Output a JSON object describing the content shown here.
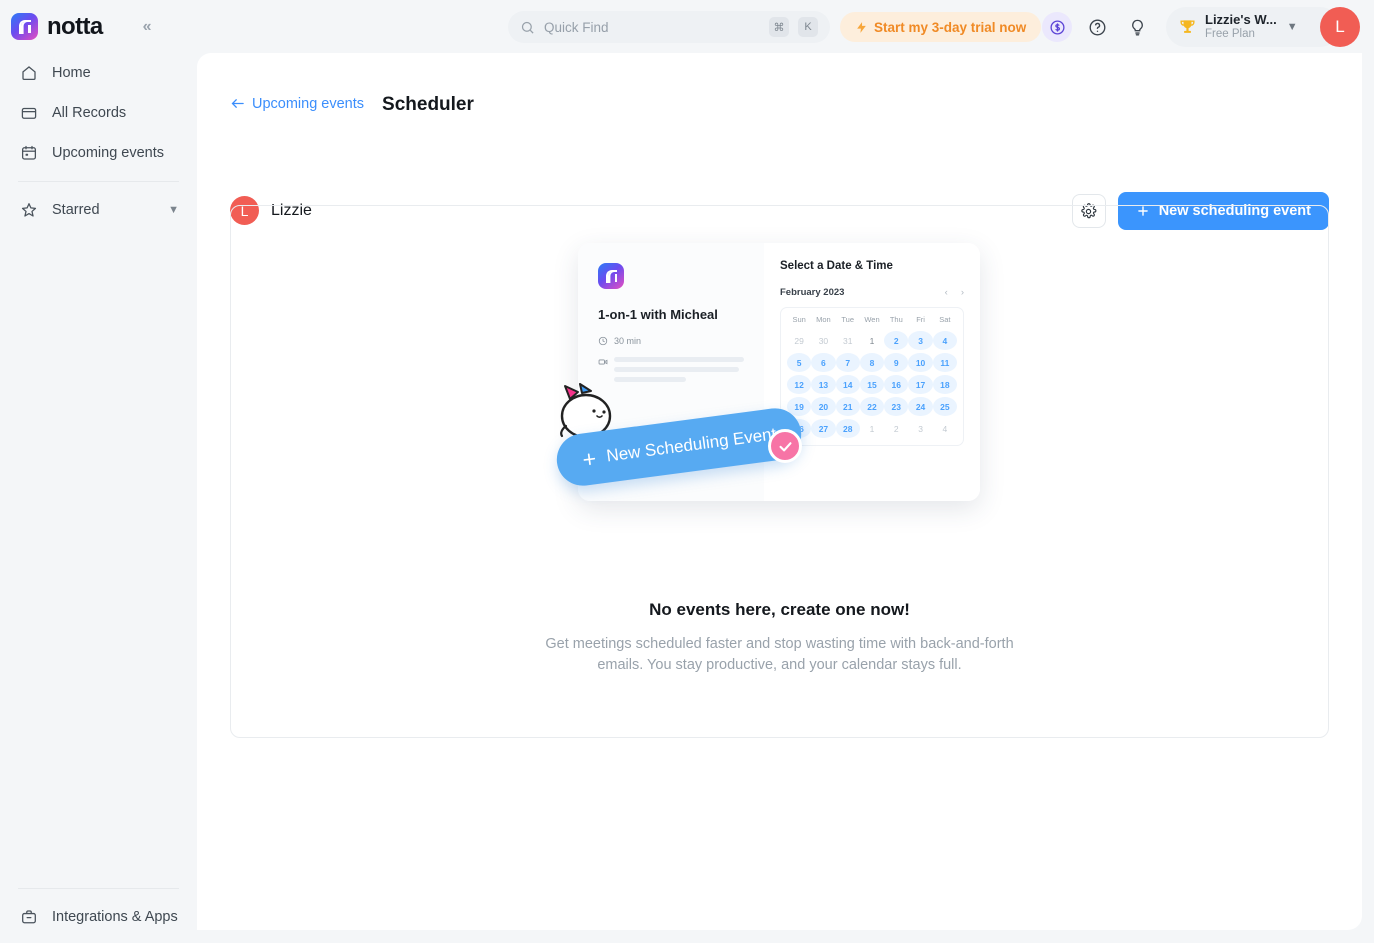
{
  "brand": {
    "name": "notta",
    "collapse_icon": "chevrons-left-icon"
  },
  "topbar": {
    "search": {
      "placeholder": "Quick Find",
      "icon": "search-icon",
      "shortcut_keys": [
        "⌘",
        "K"
      ]
    },
    "trial": {
      "label": "Start my 3-day trial now",
      "icon": "bolt-icon",
      "color": "#f08a25"
    },
    "coin_icon": "coin-dollar-icon",
    "help_icon": "help-circle-icon",
    "bulb_icon": "lightbulb-icon",
    "workspace": {
      "trophy_icon": "trophy-icon",
      "name": "Lizzie's W...",
      "plan": "Free Plan",
      "chevron_icon": "chevron-down-icon"
    },
    "avatar": {
      "initial": "L",
      "color": "#f15d54"
    }
  },
  "sidebar": {
    "items": [
      {
        "label": "Home",
        "icon": "home-icon"
      },
      {
        "label": "All Records",
        "icon": "folder-icon"
      },
      {
        "label": "Upcoming events",
        "icon": "calendar-icon"
      }
    ],
    "starred": {
      "label": "Starred",
      "icon": "star-icon",
      "chevron_icon": "chevron-down-icon"
    },
    "bottom": {
      "label": "Integrations & Apps",
      "icon": "briefcase-icon"
    }
  },
  "main": {
    "breadcrumb": {
      "back_label": "Upcoming events",
      "back_icon": "arrow-left-icon"
    },
    "title": "Scheduler",
    "owner": {
      "initial": "L",
      "name": "Lizzie",
      "color": "#f15d54"
    },
    "settings_icon": "gear-icon",
    "new_event_button": {
      "label": "New scheduling event",
      "icon": "plus-icon",
      "color": "#3b95fd"
    },
    "empty_state": {
      "title": "No events here, create one now!",
      "description": "Get meetings scheduled faster and stop wasting time with back-and-forth emails. You stay productive, and your calendar stays full.",
      "ribbon_label": "New Scheduling Event",
      "ribbon_icon": "plus-icon",
      "check_icon": "check-circle-icon",
      "mascot_icon": "cat-mascot-icon",
      "arrow_icon": "curved-arrow-icon"
    },
    "mock": {
      "logo_icon": "notta-logo-icon",
      "event_title": "1-on-1 with Micheal",
      "duration": "30 min",
      "duration_icon": "clock-icon",
      "video_icon": "video-camera-icon",
      "panel_title": "Select a Date & Time",
      "month": "February 2023",
      "prev_icon": "chevron-left-icon",
      "next_icon": "chevron-right-icon",
      "dow": [
        "Sun",
        "Mon",
        "Tue",
        "Wen",
        "Thu",
        "Fri",
        "Sat"
      ],
      "days": [
        {
          "n": "29",
          "s": "muted"
        },
        {
          "n": "30",
          "s": "muted"
        },
        {
          "n": "31",
          "s": "muted"
        },
        {
          "n": "1",
          "s": "plain"
        },
        {
          "n": "2",
          "s": "active"
        },
        {
          "n": "3",
          "s": "active"
        },
        {
          "n": "4",
          "s": "active"
        },
        {
          "n": "5",
          "s": "active"
        },
        {
          "n": "6",
          "s": "active"
        },
        {
          "n": "7",
          "s": "active"
        },
        {
          "n": "8",
          "s": "active"
        },
        {
          "n": "9",
          "s": "active"
        },
        {
          "n": "10",
          "s": "active"
        },
        {
          "n": "11",
          "s": "active"
        },
        {
          "n": "12",
          "s": "active"
        },
        {
          "n": "13",
          "s": "active"
        },
        {
          "n": "14",
          "s": "active"
        },
        {
          "n": "15",
          "s": "active"
        },
        {
          "n": "16",
          "s": "active"
        },
        {
          "n": "17",
          "s": "active"
        },
        {
          "n": "18",
          "s": "active"
        },
        {
          "n": "19",
          "s": "active"
        },
        {
          "n": "20",
          "s": "active"
        },
        {
          "n": "21",
          "s": "active"
        },
        {
          "n": "22",
          "s": "active"
        },
        {
          "n": "23",
          "s": "active"
        },
        {
          "n": "24",
          "s": "active"
        },
        {
          "n": "25",
          "s": "active"
        },
        {
          "n": "26",
          "s": "active"
        },
        {
          "n": "27",
          "s": "active"
        },
        {
          "n": "28",
          "s": "active"
        },
        {
          "n": "1",
          "s": "muted"
        },
        {
          "n": "2",
          "s": "muted"
        },
        {
          "n": "3",
          "s": "muted"
        },
        {
          "n": "4",
          "s": "muted"
        }
      ]
    }
  }
}
